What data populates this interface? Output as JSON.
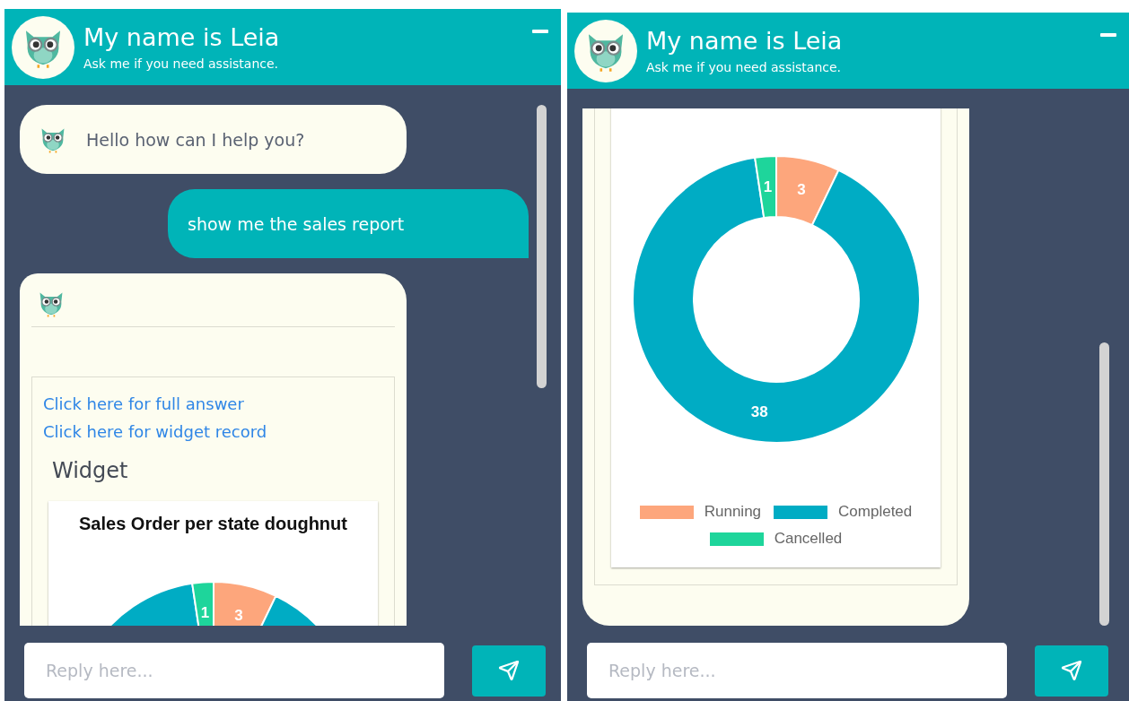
{
  "panels": [
    {
      "header": {
        "title": "My name is Leia",
        "subtitle": "Ask me if you need assistance."
      },
      "messages": [
        {
          "kind": "bot",
          "text": "Hello how can I help you?"
        },
        {
          "kind": "user",
          "text": "show me the sales report"
        },
        {
          "kind": "widget",
          "links": [
            "Click here for full answer",
            "Click here for widget record"
          ],
          "heading": "Widget",
          "chart_data": {
            "type": "donut",
            "title": "Sales Order per state doughnut",
            "values": [
              3,
              38,
              1
            ],
            "value_labels": [
              "3",
              null,
              "1"
            ]
          }
        }
      ],
      "reply": {
        "placeholder": "Reply here..."
      }
    },
    {
      "header": {
        "title": "My name is Leia",
        "subtitle": "Ask me if you need assistance."
      },
      "messages": [
        {
          "kind": "widget",
          "chart_data": {
            "type": "donut",
            "categories": [
              "Running",
              "Completed",
              "Cancelled"
            ],
            "values": [
              3,
              38,
              1
            ],
            "data_labels": true
          }
        }
      ],
      "reply": {
        "placeholder": "Reply here..."
      }
    }
  ]
}
